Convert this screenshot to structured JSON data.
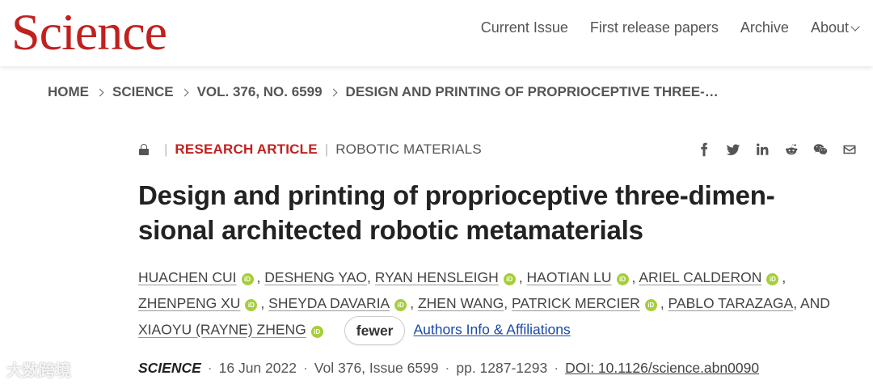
{
  "header": {
    "logo": "Science",
    "nav": [
      "Current Issue",
      "First release papers",
      "Archive",
      "About"
    ]
  },
  "breadcrumb": [
    "HOME",
    "SCIENCE",
    "VOL. 376, NO. 6599",
    "DESIGN AND PRINTING OF PROPRIOCEPTIVE THREE-…"
  ],
  "meta": {
    "article_type": "RESEARCH ARTICLE",
    "category": "ROBOTIC MATERIALS"
  },
  "share_icons": [
    "facebook-icon",
    "twitter-icon",
    "linkedin-icon",
    "reddit-icon",
    "wechat-icon",
    "email-icon"
  ],
  "title": "Design and printing of proprioceptive three-dimen-sional architected robotic metamaterials",
  "authors": [
    {
      "name": "HUACHEN CUI",
      "orcid": true,
      "sep": ", "
    },
    {
      "name": "DESHENG YAO",
      "orcid": false,
      "sep": ", "
    },
    {
      "name": "RYAN HENSLEIGH",
      "orcid": true,
      "sep": ", "
    },
    {
      "name": "HAOTIAN LU",
      "orcid": true,
      "sep": ", "
    },
    {
      "name": "ARIEL CALDERON",
      "orcid": true,
      "sep": ", "
    },
    {
      "name": "ZHENPENG XU",
      "orcid": true,
      "sep": ", "
    },
    {
      "name": "SHEYDA DAVARIA",
      "orcid": true,
      "sep": ", "
    },
    {
      "name": "ZHEN WANG",
      "orcid": false,
      "sep": ", "
    },
    {
      "name": "PATRICK MERCIER",
      "orcid": true,
      "sep": ", "
    },
    {
      "name": "PABLO TARAZAGA",
      "orcid": false,
      "sep": ", "
    },
    {
      "name": "XIAOYU (RAYNE) ZHENG",
      "orcid": true,
      "sep": ""
    }
  ],
  "and_label": "AND",
  "fewer_label": "fewer",
  "affiliations_label": "Authors Info & Affiliations",
  "citation": {
    "journal": "SCIENCE",
    "date": "16 Jun 2022",
    "volume": "Vol 376, Issue 6599",
    "pages": "pp. 1287-1293",
    "doi": "DOI: 10.1126/science.abn0090"
  },
  "watermark": "大数跨境",
  "colors": {
    "brand": "#c0211f",
    "orcid": "#a6ce39",
    "link": "#1a4aa8"
  }
}
